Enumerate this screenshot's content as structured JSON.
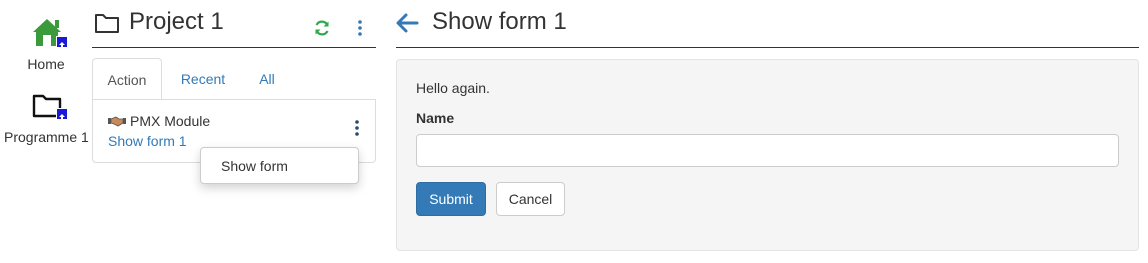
{
  "nav": {
    "home_label": "Home",
    "programme_label": "Programme 1"
  },
  "project": {
    "title": "Project 1",
    "tabs": [
      {
        "label": "Action"
      },
      {
        "label": "Recent"
      },
      {
        "label": "All"
      }
    ],
    "card": {
      "module_label": "PMX Module",
      "form_link": "Show form 1"
    },
    "dropdown": {
      "item_label": "Show form"
    }
  },
  "form": {
    "title": "Show form 1",
    "greeting": "Hello again.",
    "name_label": "Name",
    "name_value": "",
    "submit_label": "Submit",
    "cancel_label": "Cancel"
  },
  "colors": {
    "link": "#337ab7",
    "primary": "#337ab7",
    "refresh_icon": "#2ea84a",
    "home_icon": "#3b9a3b",
    "badge": "#1a1ad6"
  },
  "icons": [
    "home-icon",
    "folder-icon",
    "upload-badge-icon",
    "refresh-icon",
    "kebab-menu-icon",
    "handshake-icon",
    "back-arrow-icon"
  ]
}
